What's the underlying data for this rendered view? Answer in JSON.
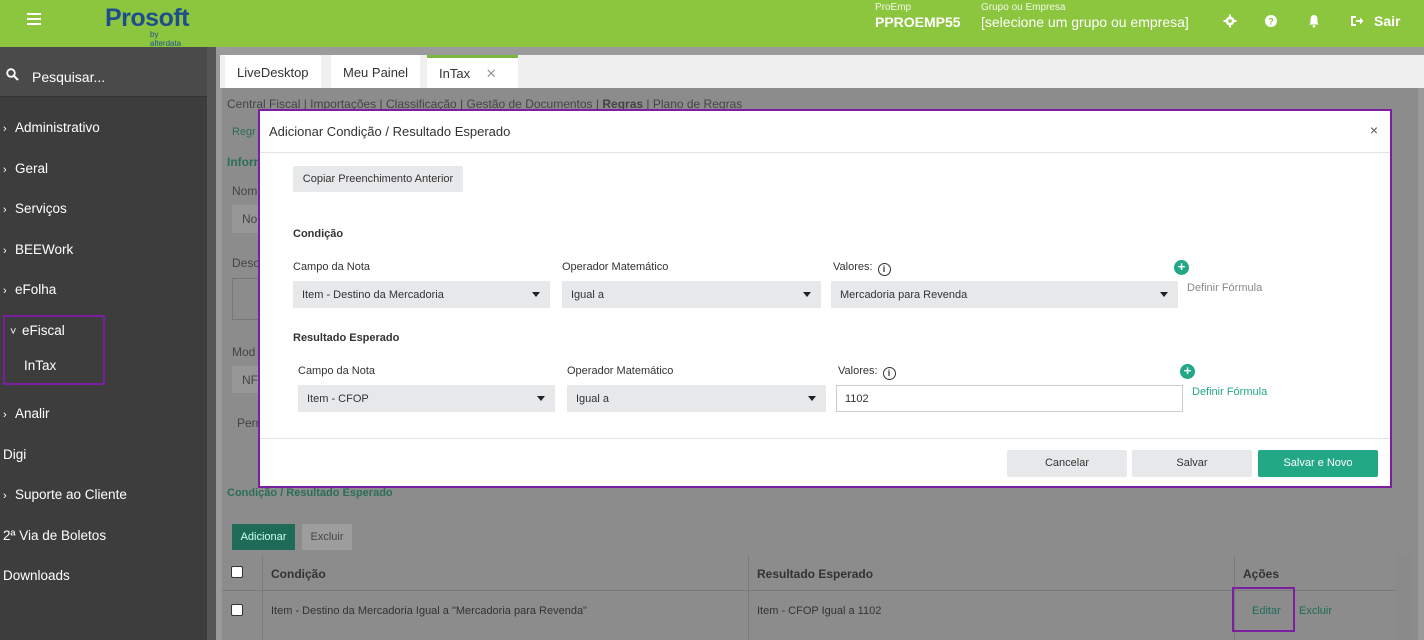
{
  "topbar": {
    "logo": "Prosoft",
    "logo_sub": "by alterdata",
    "proemp_label": "ProEmp",
    "proemp_value": "PPROEMP55",
    "grupo_label": "Grupo ou Empresa",
    "grupo_value": "[selecione um grupo ou empresa]",
    "sair": "Sair",
    "icons": [
      "menu-icon",
      "gear-icon",
      "help-icon",
      "bell-icon",
      "logout-icon"
    ]
  },
  "sidebar": {
    "search": "Pesquisar...",
    "items": [
      {
        "label": "Administrativo",
        "chevron": "›"
      },
      {
        "label": "Geral",
        "chevron": "›"
      },
      {
        "label": "Serviços",
        "chevron": "›"
      },
      {
        "label": "BEEWork",
        "chevron": "›"
      },
      {
        "label": "eFolha",
        "chevron": "›"
      },
      {
        "label": "eFiscal",
        "chevron": "˅"
      },
      {
        "label": "InTax",
        "chevron": ""
      },
      {
        "label": "Analir",
        "chevron": "›"
      },
      {
        "label": "Digi",
        "chevron": ""
      },
      {
        "label": "Suporte ao Cliente",
        "chevron": "›"
      },
      {
        "label": "2ª Via de Boletos",
        "chevron": ""
      },
      {
        "label": "Downloads",
        "chevron": ""
      }
    ]
  },
  "tabs": [
    "LiveDesktop",
    "Meu Painel",
    "InTax"
  ],
  "subnav": [
    "Central Fiscal",
    "Importações",
    "Classificação",
    "Gestão de Documentos",
    "Regras",
    "Plano de Regras"
  ],
  "background_fragments": {
    "regr": "Regr",
    "inform": "Inform",
    "nom": "Nom",
    "no": "No",
    "desc": "Desc",
    "mod": "Mod",
    "nf": "NF",
    "perr": "Perr",
    "section": "Condição / Resultado Esperado",
    "adicionar": "Adicionar",
    "excluir": "Excluir"
  },
  "modal": {
    "title": "Adicionar Condição / Resultado Esperado",
    "close": "×",
    "copy_button": "Copiar Preenchimento Anterior",
    "condicao": {
      "title": "Condição",
      "campo_label": "Campo da Nota",
      "campo_value": "Item - Destino da Mercadoria",
      "operador_label": "Operador Matemático",
      "operador_value": "Igual a",
      "valores_label": "Valores:",
      "valores_value": "Mercadoria para Revenda",
      "formula": "Definir Fórmula"
    },
    "resultado": {
      "title": "Resultado Esperado",
      "campo_label": "Campo da Nota",
      "campo_value": "Item - CFOP",
      "operador_label": "Operador Matemático",
      "operador_value": "Igual a",
      "valores_label": "Valores:",
      "valores_value": "1102",
      "formula": "Definir Fórmula"
    },
    "buttons": {
      "cancelar": "Cancelar",
      "salvar": "Salvar",
      "salvar_novo": "Salvar e Novo"
    }
  },
  "table": {
    "headers": [
      "Condição",
      "Resultado Esperado",
      "Ações"
    ],
    "row": {
      "condicao": "Item - Destino da Mercadoria Igual a \"Mercadoria para Revenda\"",
      "resultado": "Item - CFOP Igual a 1102",
      "editar": "Editar",
      "excluir": "Excluir"
    }
  },
  "colors": {
    "topbar": "#8cc63f",
    "accent": "#22a884",
    "highlight": "#7b1fa2",
    "sidebar": "#3d3d3d"
  }
}
